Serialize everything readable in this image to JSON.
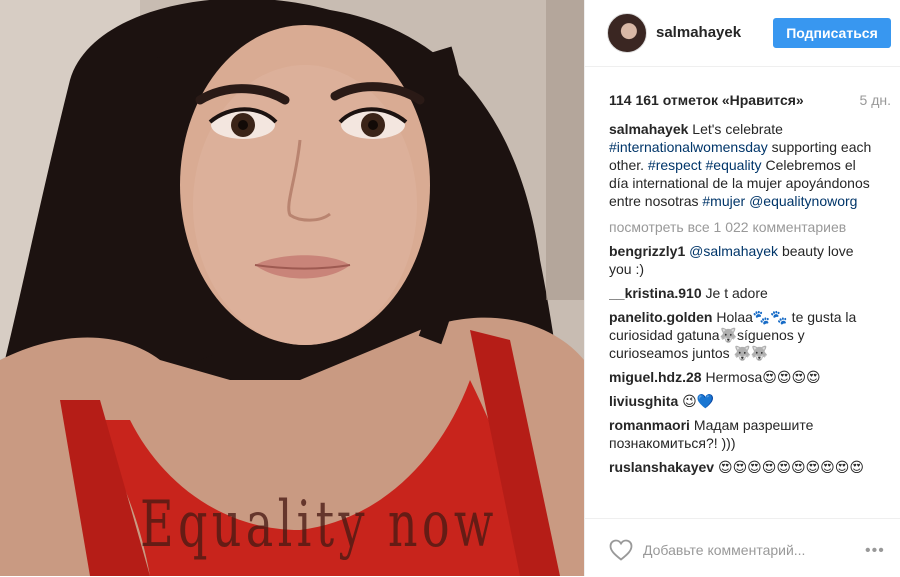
{
  "photo": {
    "alt_caption": "Equality now"
  },
  "header": {
    "username": "salmahayek",
    "follow_label": "Подписаться"
  },
  "post": {
    "likes": "114 161 отметок «Нравится»",
    "age": "5 дн."
  },
  "caption": {
    "author": "salmahayek",
    "text_1": "Let's celebrate",
    "tag_1": "#internationalwomensday",
    "text_2": "supporting each other.",
    "tag_2": "#respect",
    "tag_3": "#equality",
    "text_3": "Celebremos el día international de la mujer apoyándonos entre nosotras",
    "tag_4": "#mujer",
    "tag_5": "@equalitynoworg"
  },
  "view_all": "посмотреть все 1 022 комментариев",
  "comments": [
    {
      "author": "bengrizzly1",
      "mention": "@salmahayek",
      "text": "beauty love you :)"
    },
    {
      "author": "__kristina.910",
      "text": "Je t adore"
    },
    {
      "author": "panelito.golden",
      "text": "Holaa🐾🐾 te gusta la curiosidad gatuna🐺síguenos y curioseamos juntos 🐺🐺"
    },
    {
      "author": "miguel.hdz.28",
      "text": "Hermosa😍😍😍😍"
    },
    {
      "author": "liviusghita",
      "text": "😉💙"
    },
    {
      "author": "romanmaori",
      "text": "Мадам разрешите познакомиться?! )))"
    },
    {
      "author": "ruslanshakayev",
      "text": "😍😍😍😍😍😍😍😍😍😍"
    }
  ],
  "footer": {
    "comment_placeholder": "Добавьте комментарий...",
    "more_label": "•••"
  },
  "colors": {
    "accent": "#3897f0",
    "hashtag": "#003569",
    "muted": "#999999"
  },
  "icons": [
    "heart-icon",
    "more-options-icon"
  ]
}
